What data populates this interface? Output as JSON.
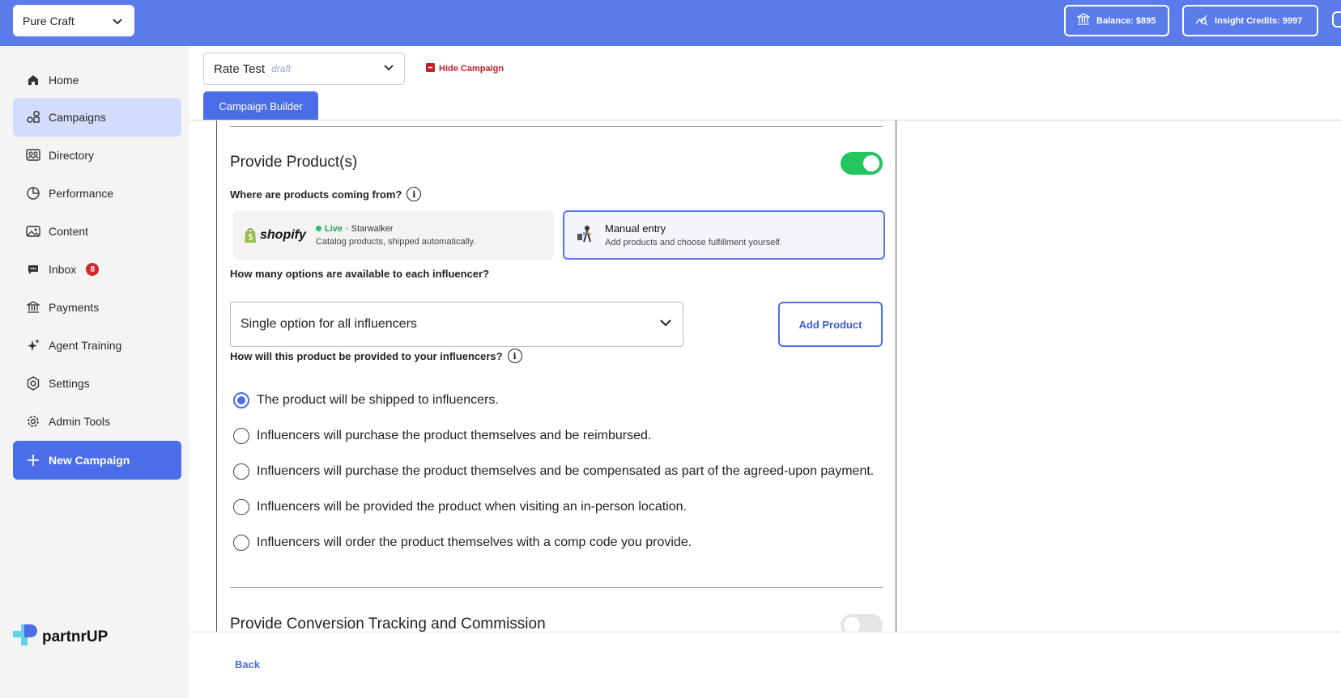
{
  "topbar": {
    "org_name": "Pure Craft",
    "balance": "Balance: $895",
    "credits": "Insight Credits: 9997"
  },
  "sidebar": {
    "items": [
      {
        "label": "Home",
        "icon": "home-icon"
      },
      {
        "label": "Campaigns",
        "icon": "campaigns-icon"
      },
      {
        "label": "Directory",
        "icon": "directory-icon"
      },
      {
        "label": "Performance",
        "icon": "performance-icon"
      },
      {
        "label": "Content",
        "icon": "image-icon"
      },
      {
        "label": "Inbox",
        "icon": "chat-icon",
        "badge": "8"
      },
      {
        "label": "Payments",
        "icon": "bank-icon"
      },
      {
        "label": "Agent Training",
        "icon": "sparkle-icon"
      },
      {
        "label": "Settings",
        "icon": "settings-icon"
      },
      {
        "label": "Admin Tools",
        "icon": "gear-icon"
      }
    ],
    "new_campaign": "New Campaign",
    "logo_text": "partnrUP"
  },
  "header": {
    "campaign_name": "Rate Test",
    "campaign_status": "draft",
    "hide_label": "Hide Campaign",
    "tab_label": "Campaign Builder"
  },
  "products": {
    "title": "Provide Product(s)",
    "enabled": true,
    "source_question": "Where are products coming from?",
    "shopify": {
      "logo": "shopify",
      "status": "Live",
      "store": "· Starwalker",
      "desc": "Catalog products, shipped automatically."
    },
    "manual": {
      "title": "Manual entry",
      "desc": "Add products and choose fulfillment yourself."
    },
    "options_question": "How many options are available to each influencer?",
    "options_value": "Single option for all influencers",
    "add_product": "Add Product",
    "provide_question": "How will this product be provided to your influencers?",
    "provide_options": [
      {
        "label": "The product will be shipped to influencers.",
        "checked": true
      },
      {
        "label": "Influencers will purchase the product themselves and be reimbursed.",
        "checked": false
      },
      {
        "label": "Influencers will purchase the product themselves and be compensated as part of the agreed-upon payment.",
        "checked": false
      },
      {
        "label": "Influencers will be provided the product when visiting an in-person location.",
        "checked": false
      },
      {
        "label": "Influencers will order the product themselves with a comp code you provide.",
        "checked": false
      }
    ]
  },
  "conversion": {
    "title": "Provide Conversion Tracking and Commission",
    "enabled": false
  },
  "footer": {
    "back": "Back"
  },
  "colors": {
    "brand": "#5b7bea",
    "primary": "#4a6ee8",
    "toggle_on": "#22c55e",
    "danger": "#c21f2a"
  }
}
